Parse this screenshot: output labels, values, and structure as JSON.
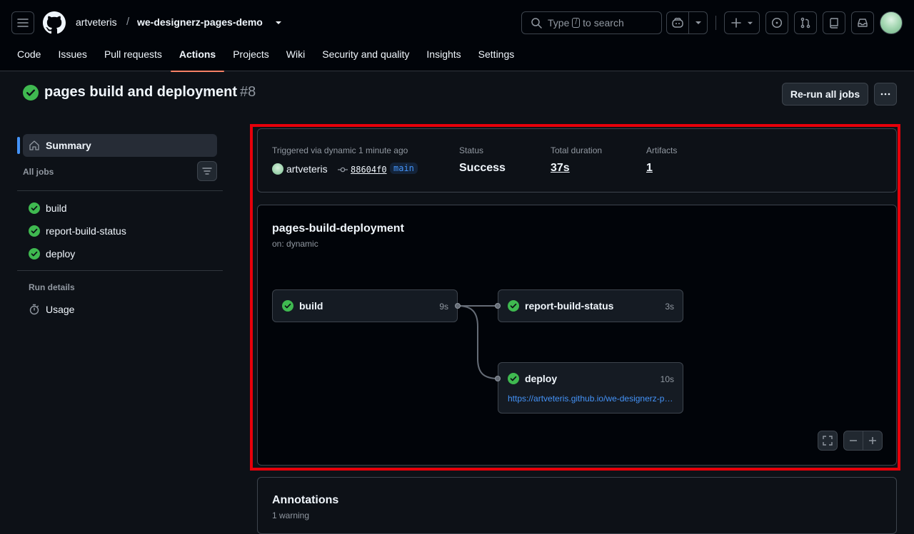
{
  "repo": {
    "owner": "artveteris",
    "separator": "/",
    "name": "we-designerz-pages-demo"
  },
  "search": {
    "prefix": "Type",
    "key": "/",
    "suffix": "to search"
  },
  "tabs": [
    {
      "label": "Code"
    },
    {
      "label": "Issues"
    },
    {
      "label": "Pull requests"
    },
    {
      "label": "Actions"
    },
    {
      "label": "Projects"
    },
    {
      "label": "Wiki"
    },
    {
      "label": "Security and quality"
    },
    {
      "label": "Insights"
    },
    {
      "label": "Settings"
    }
  ],
  "run": {
    "title": "pages build and deployment",
    "number": "#8",
    "rerun_label": "Re-run all jobs"
  },
  "sidebar": {
    "summary": "Summary",
    "all_jobs": "All jobs",
    "jobs": [
      {
        "label": "build"
      },
      {
        "label": "report-build-status"
      },
      {
        "label": "deploy"
      }
    ],
    "run_details": "Run details",
    "usage": "Usage"
  },
  "summary": {
    "triggered": "Triggered via dynamic 1 minute ago",
    "actor": "artveteris",
    "sha": "88604f0",
    "branch": "main",
    "status_label": "Status",
    "status": "Success",
    "duration_label": "Total duration",
    "duration": "37s",
    "artifacts_label": "Artifacts",
    "artifacts": "1"
  },
  "workflow": {
    "name": "pages-build-deployment",
    "trigger": "on: dynamic",
    "jobs": {
      "build": {
        "name": "build",
        "duration": "9s"
      },
      "report": {
        "name": "report-build-status",
        "duration": "3s"
      },
      "deploy": {
        "name": "deploy",
        "duration": "10s",
        "url": "https://artveteris.github.io/we-designerz-pages-demo/"
      }
    }
  },
  "annotations": {
    "title": "Annotations",
    "subtitle": "1 warning"
  },
  "colors": {
    "success": "#3fb950",
    "accent": "#4493f8",
    "highlight": "#e6000a",
    "tab_underline": "#f78166"
  }
}
